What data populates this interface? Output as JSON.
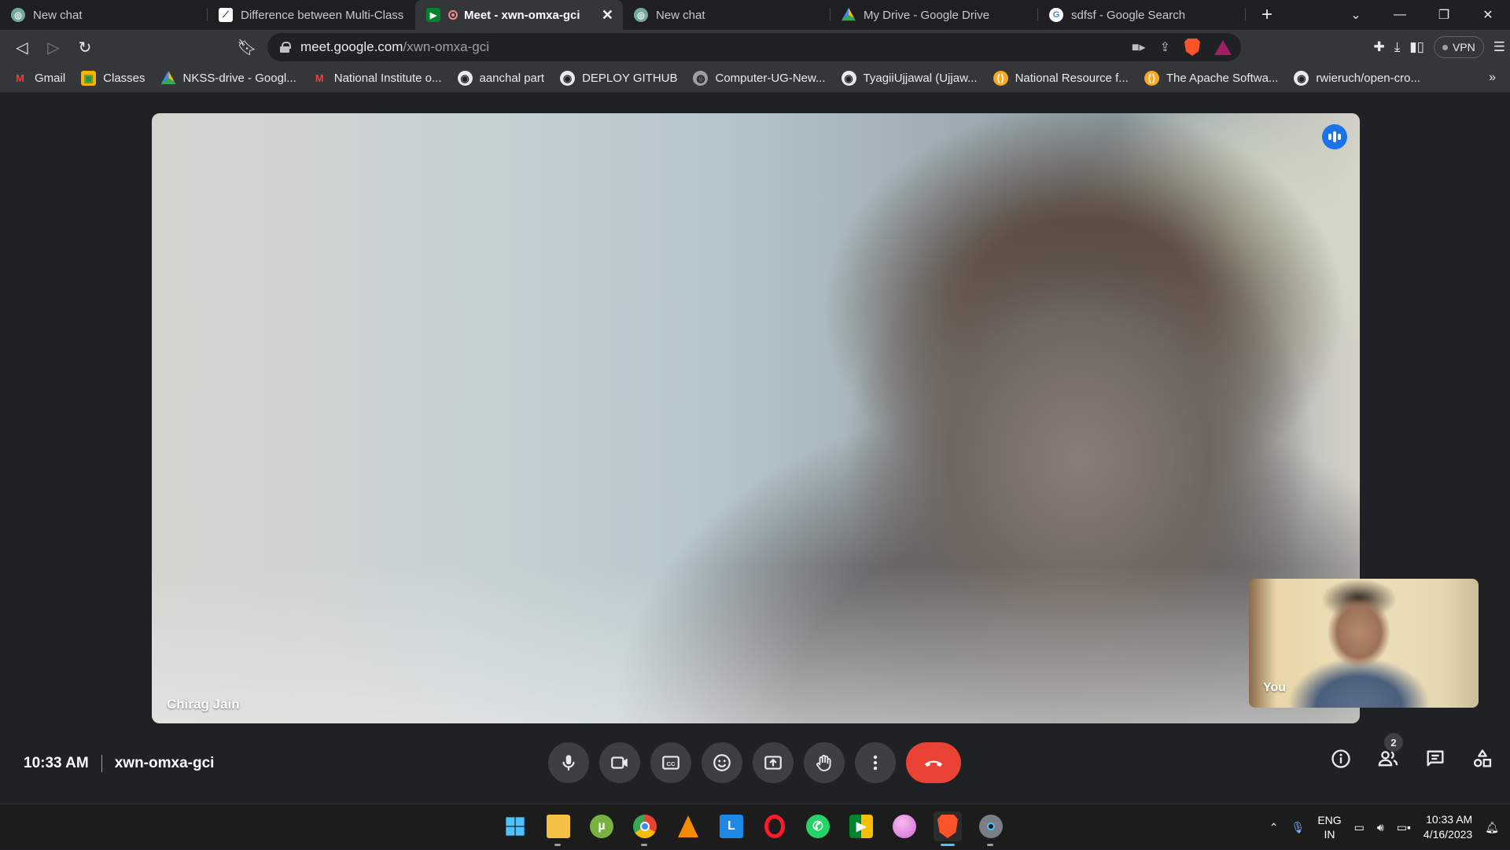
{
  "browser": {
    "tabs": [
      {
        "title": "New chat",
        "icon": "chatgpt-icon",
        "active": false
      },
      {
        "title": "Difference between Multi-Class a",
        "icon": "chart-icon",
        "active": false
      },
      {
        "title": "Meet - xwn-omxa-gci",
        "icon": "google-meet-icon",
        "active": true
      },
      {
        "title": "New chat",
        "icon": "chatgpt-icon",
        "active": false
      },
      {
        "title": "My Drive - Google Drive",
        "icon": "google-drive-icon",
        "active": false
      },
      {
        "title": "sdfsf - Google Search",
        "icon": "google-icon",
        "active": false
      }
    ],
    "new_tab_label": "+",
    "url_host": "meet.google.com",
    "url_path": "/xwn-omxa-gci",
    "vpn_label": "VPN",
    "bookmarks": [
      {
        "label": "Gmail",
        "icon": "gmail-icon"
      },
      {
        "label": "Classes",
        "icon": "classroom-icon"
      },
      {
        "label": "NKSS-drive - Googl...",
        "icon": "google-drive-icon"
      },
      {
        "label": "National Institute o...",
        "icon": "gmail-icon"
      },
      {
        "label": "aanchal part",
        "icon": "github-icon"
      },
      {
        "label": "DEPLOY GITHUB",
        "icon": "github-icon"
      },
      {
        "label": "Computer-UG-New...",
        "icon": "globe-icon"
      },
      {
        "label": "TyagiiUjjawal (Ujjaw...",
        "icon": "github-icon"
      },
      {
        "label": "National Resource f...",
        "icon": "code-icon"
      },
      {
        "label": "The Apache Softwa...",
        "icon": "code-icon"
      },
      {
        "label": "rwieruch/open-cro...",
        "icon": "github-icon"
      }
    ],
    "bookmarks_more": "»"
  },
  "meeting": {
    "main_participant_name": "Chirag Jain",
    "self_label": "You",
    "time": "10:33 AM",
    "meeting_code": "xwn-omxa-gci",
    "participant_count": "2"
  },
  "taskbar": {
    "lang_line1": "ENG",
    "lang_line2": "IN",
    "time": "10:33 AM",
    "date": "4/16/2023"
  },
  "colors": {
    "end_call": "#ea4335",
    "speaking_indicator": "#1a73e8",
    "meet_bg": "#202124"
  }
}
